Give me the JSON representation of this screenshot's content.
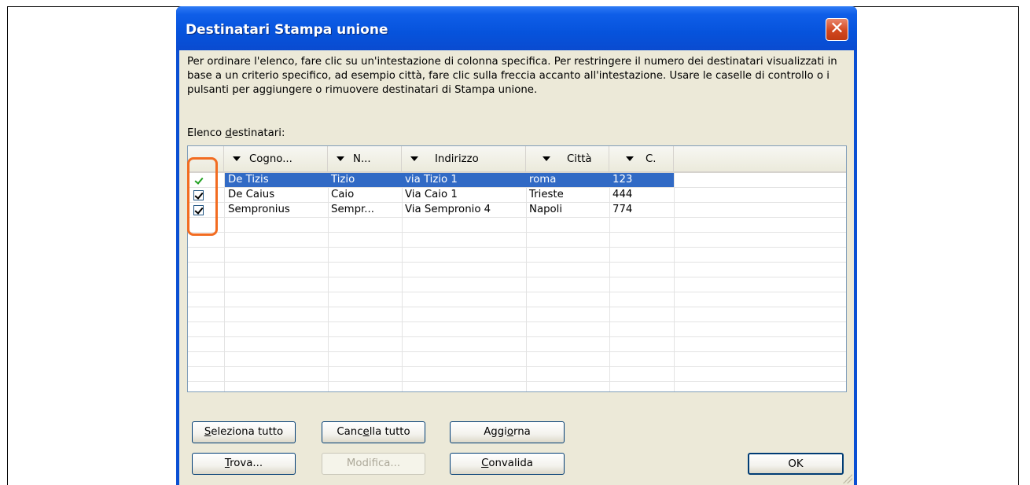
{
  "window": {
    "title": "Destinatari Stampa unione",
    "close_glyph": "✕"
  },
  "description": "Per ordinare l'elenco, fare clic su un'intestazione di colonna specifica. Per restringere il numero dei destinatari visualizzati in base a un criterio specifico, ad esempio città, fare clic sulla freccia accanto all'intestazione. Usare le caselle di controllo o i pulsanti per aggiungere o rimuovere destinatari di Stampa unione.",
  "list_label": {
    "before": "Elenco ",
    "accel": "d",
    "after": "estinatari:"
  },
  "columns": [
    "Cogno...",
    "N...",
    "Indirizzo",
    "Città",
    "C."
  ],
  "rows": [
    {
      "checked": true,
      "selected": true,
      "cells": [
        "De Tizis",
        "Tizio",
        "via Tizio 1",
        "roma",
        "123"
      ]
    },
    {
      "checked": true,
      "selected": false,
      "cells": [
        "De Caius",
        "Caio",
        "Via Caio 1",
        "Trieste",
        "444"
      ]
    },
    {
      "checked": true,
      "selected": false,
      "cells": [
        "Sempronius",
        "Sempr...",
        "Via Sempronio 4",
        "Napoli",
        "774"
      ]
    }
  ],
  "buttons": {
    "select_all": {
      "accel": "S",
      "rest": "eleziona tutto"
    },
    "clear_all": {
      "before": "Canc",
      "accel": "e",
      "after": "lla tutto"
    },
    "refresh": {
      "before": "Aggi",
      "accel": "o",
      "after": "rna"
    },
    "find": {
      "accel": "T",
      "rest": "rova..."
    },
    "edit": "Modifica...",
    "validate": {
      "accel": "C",
      "rest": "onvalida"
    },
    "ok": "OK"
  },
  "colors": {
    "title_bar": "#0653dc",
    "selection": "#316ac5",
    "highlight": "#f26c21",
    "dialog_bg": "#ece9d8"
  },
  "icons": {
    "close": "close-icon",
    "dropdown": "dropdown-arrow-icon",
    "check": "checkbox-checked-icon"
  }
}
